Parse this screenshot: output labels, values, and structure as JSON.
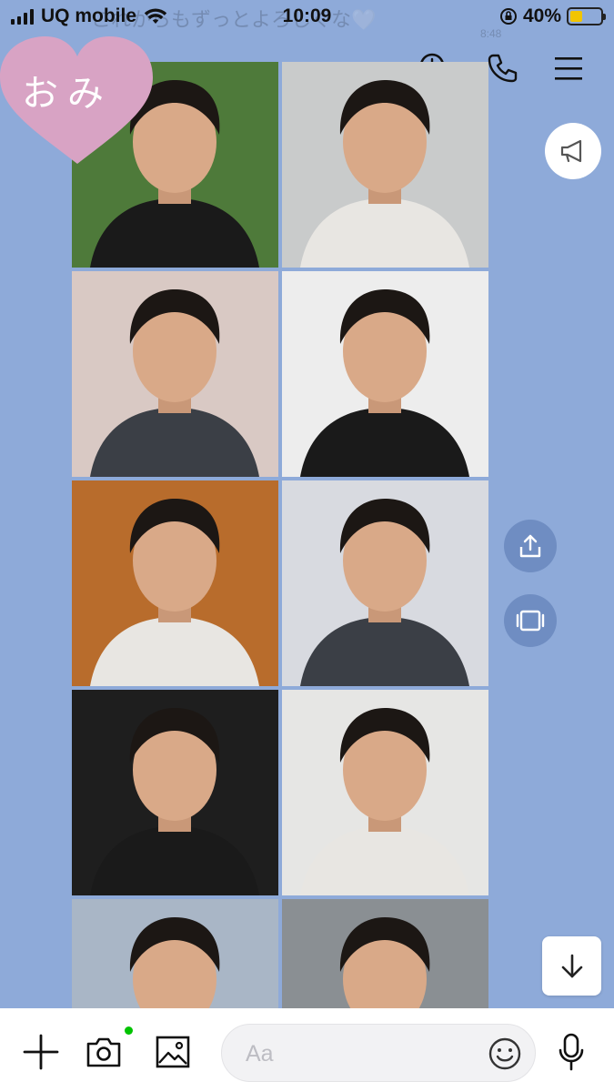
{
  "status_bar": {
    "carrier": "UQ mobile",
    "time": "10:09",
    "battery": "40%",
    "battery_level": 0.4,
    "battery_color": "#F2C500"
  },
  "preview": {
    "message": "これからもずっとよろしくな🤍",
    "time": "8:48"
  },
  "badge": {
    "text": "おみ",
    "color": "#D8A3C4"
  },
  "header_icons": [
    "search-clock-icon",
    "phone-icon",
    "menu-icon"
  ],
  "photos": [
    {
      "name": "photo-1",
      "bg": "#4E7A3A"
    },
    {
      "name": "photo-2",
      "bg": "#C9CBCB"
    },
    {
      "name": "photo-3",
      "bg": "#D9C9C4"
    },
    {
      "name": "photo-4",
      "bg": "#EDEDED"
    },
    {
      "name": "photo-5",
      "bg": "#B86C2C"
    },
    {
      "name": "photo-6",
      "bg": "#D8DAE0"
    },
    {
      "name": "photo-7",
      "bg": "#1E1E1E"
    },
    {
      "name": "photo-8",
      "bg": "#E6E6E4"
    },
    {
      "name": "photo-9",
      "bg": "#A9B6C6"
    },
    {
      "name": "photo-10",
      "bg": "#8A8F93"
    }
  ],
  "side_buttons": [
    "megaphone-icon",
    "share-icon",
    "screen-icon"
  ],
  "input": {
    "placeholder": "Aa"
  },
  "colors": {
    "background": "#8EAAD9",
    "side_button": "#6F8DC2",
    "online_dot": "#00C300"
  }
}
